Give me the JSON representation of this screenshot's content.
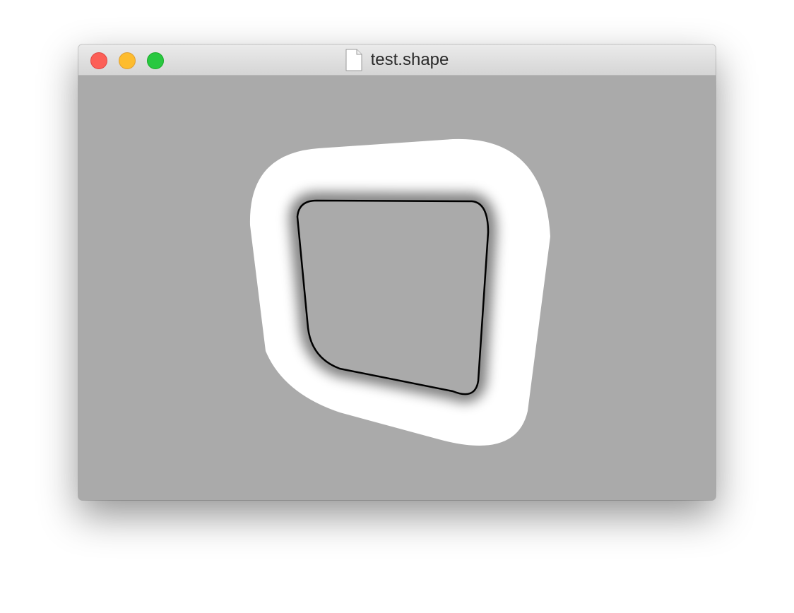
{
  "window": {
    "title": "test.shape",
    "document_icon": "document-icon"
  },
  "traffic_lights": {
    "close_color": "#fc5f57",
    "minimize_color": "#fdbc2e",
    "zoom_color": "#28c840"
  },
  "canvas": {
    "background": "#aaaaaa",
    "shape_color": "#ffffff",
    "outline_color": "#000000"
  }
}
